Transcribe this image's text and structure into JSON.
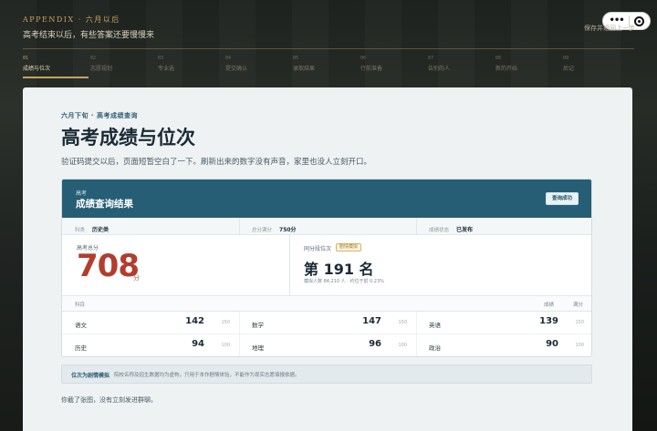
{
  "header": {
    "eyebrow": "APPENDIX · 六月以后",
    "subtitle": "高考结束以后，有些答案还要慢慢来",
    "save_hint": "保存并返回上一步"
  },
  "steps": [
    {
      "num": "01",
      "label": "成绩与位次"
    },
    {
      "num": "02",
      "label": "志愿规划"
    },
    {
      "num": "03",
      "label": "专业选"
    },
    {
      "num": "04",
      "label": "提交确认"
    },
    {
      "num": "05",
      "label": "录取结果"
    },
    {
      "num": "06",
      "label": "行前准备"
    },
    {
      "num": "07",
      "label": "告别的人"
    },
    {
      "num": "08",
      "label": "新的开始"
    },
    {
      "num": "09",
      "label": "后记"
    }
  ],
  "page": {
    "kicker": "六月下旬 · 高考成绩查询",
    "title": "高考成绩与位次",
    "lead": "验证码提交以后，页面短暂空白了一下。刷新出来的数字没有声音，家里也没人立刻开口。"
  },
  "card": {
    "head_small": "高考",
    "head_title": "成绩查询结果",
    "status_label": "查询成功",
    "meta": [
      {
        "k": "科类",
        "v": "历史类"
      },
      {
        "k": "总分满分",
        "v": "750分"
      },
      {
        "k": "成绩状态",
        "v": "已发布"
      }
    ],
    "score_label": "高考总分",
    "score": "708",
    "score_unit": "分",
    "rank_label": "同分段位次",
    "rank_badge": "剧情模拟",
    "rank_text": "第 191 名",
    "rank_note": "模拟人数 84,210 人 · 约位于前 0.23%",
    "subjects_header": {
      "subject": "科目",
      "score": "成绩",
      "full": "满分"
    },
    "subjects": [
      [
        {
          "name": "语文",
          "score": "142",
          "full": "150"
        },
        {
          "name": "数学",
          "score": "147",
          "full": "150"
        },
        {
          "name": "英语",
          "score": "139",
          "full": "150"
        }
      ],
      [
        {
          "name": "历史",
          "score": "94",
          "full": "100"
        },
        {
          "name": "地理",
          "score": "96",
          "full": "100"
        },
        {
          "name": "政治",
          "score": "90",
          "full": "100"
        }
      ]
    ]
  },
  "note": {
    "k": "位次为剧情模拟",
    "v": "院校名称及招生数据均为虚构，只用于本作剧情体验，不能作为现实志愿填报依据。"
  },
  "footer": "你截了张图，没有立刻发进群聊。",
  "colors": {
    "accent": "#c8a35f",
    "header_bg": "#265f75",
    "score": "#b23d2e"
  }
}
